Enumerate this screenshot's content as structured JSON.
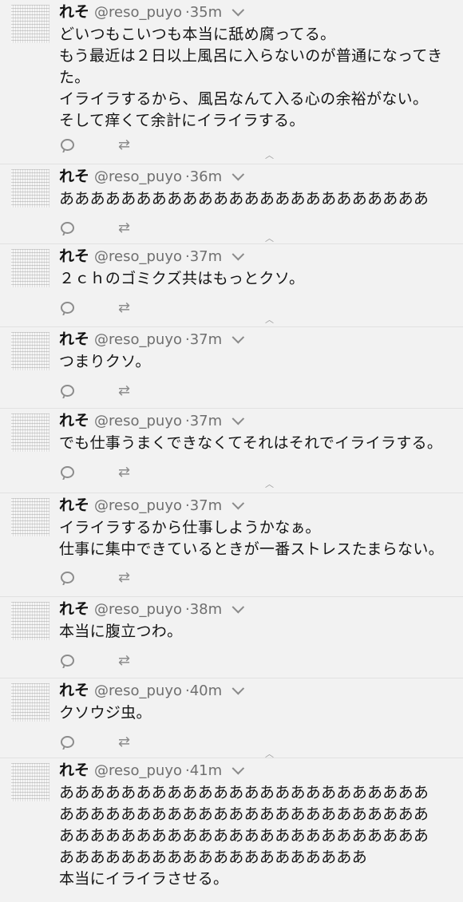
{
  "tweets": [
    {
      "name": "れそ",
      "handle": "@reso_puyo",
      "sep": "·",
      "time": "35m",
      "lines": [
        "どいつもこいつも本当に舐め腐ってる。",
        "もう最近は２日以上風呂に入らないのが普通になってき",
        "た。",
        "イライラするから、風呂なんて入る心の余裕がない。",
        "そして痒くて余計にイライラする。"
      ]
    },
    {
      "name": "れそ",
      "handle": "@reso_puyo",
      "sep": "·",
      "time": "36m",
      "lines": [
        "ああああああああああああああああああああああああ"
      ]
    },
    {
      "name": "れそ",
      "handle": "@reso_puyo",
      "sep": "·",
      "time": "37m",
      "lines": [
        "２ｃｈのゴミクズ共はもっとクソ。"
      ]
    },
    {
      "name": "れそ",
      "handle": "@reso_puyo",
      "sep": "·",
      "time": "37m",
      "lines": [
        "つまりクソ。"
      ]
    },
    {
      "name": "れそ",
      "handle": "@reso_puyo",
      "sep": "·",
      "time": "37m",
      "lines": [
        "でも仕事うまくできなくてそれはそれでイライラする。"
      ]
    },
    {
      "name": "れそ",
      "handle": "@reso_puyo",
      "sep": "·",
      "time": "37m",
      "lines": [
        "イライラするから仕事しようかなぁ。",
        "仕事に集中できているときが一番ストレスたまらない。"
      ]
    },
    {
      "name": "れそ",
      "handle": "@reso_puyo",
      "sep": "·",
      "time": "38m",
      "lines": [
        "本当に腹立つわ。"
      ]
    },
    {
      "name": "れそ",
      "handle": "@reso_puyo",
      "sep": "·",
      "time": "40m",
      "lines": [
        "クソウジ虫。"
      ]
    },
    {
      "name": "れそ",
      "handle": "@reso_puyo",
      "sep": "·",
      "time": "41m",
      "lines": [
        "ああああああああああああああああああああああああ",
        "ああああああああああああああああああああああああ",
        "ああああああああああああああああああああああああ",
        "ああああああああああああああああああああ",
        "本当にイライラさせる。"
      ]
    }
  ],
  "icons": {
    "reply": "reply-icon",
    "retweet": "retweet-icon",
    "more": "more-icon",
    "caret": "chevron-down-icon",
    "retweet_glyph": "⇄"
  }
}
